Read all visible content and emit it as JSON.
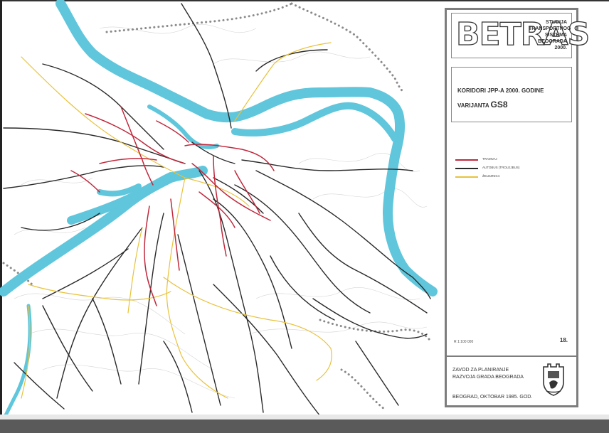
{
  "header": {
    "logo": "BETRAS",
    "study_lines": [
      "STUDIJA",
      "TRANSPORTNOG",
      "SISTEMA",
      "BEOGRADA",
      "2000."
    ]
  },
  "title": {
    "line1": "KORIDORI JPP-A 2000. GODINE",
    "line2_prefix": "VARIJANTA",
    "line2_variant": "GS8"
  },
  "legend": [
    {
      "label": "TRAMVAJ",
      "color": "#c0283c"
    },
    {
      "label": "AUTOBUS (TROLEJBUS)",
      "color": "#2a2a2a"
    },
    {
      "label": "ŽELEZNICA",
      "color": "#e8c23a"
    }
  ],
  "footer": {
    "scale": "R 1:100 000",
    "sheet": "18.",
    "institution_lines": [
      "ZAVOD ZA PLANIRANJE",
      "RAZVOJA GRADA BEOGRADA"
    ],
    "date": "BEOGRAD, OKTOBAR 1985. GOD."
  },
  "map_colors": {
    "river": "#5fc6dc",
    "tram": "#c0283c",
    "bus": "#2a2a2a",
    "rail": "#e8c23a",
    "boundary": "#8a8a8a"
  },
  "icons": {
    "emblem": "belgrade-coat-of-arms-icon"
  }
}
